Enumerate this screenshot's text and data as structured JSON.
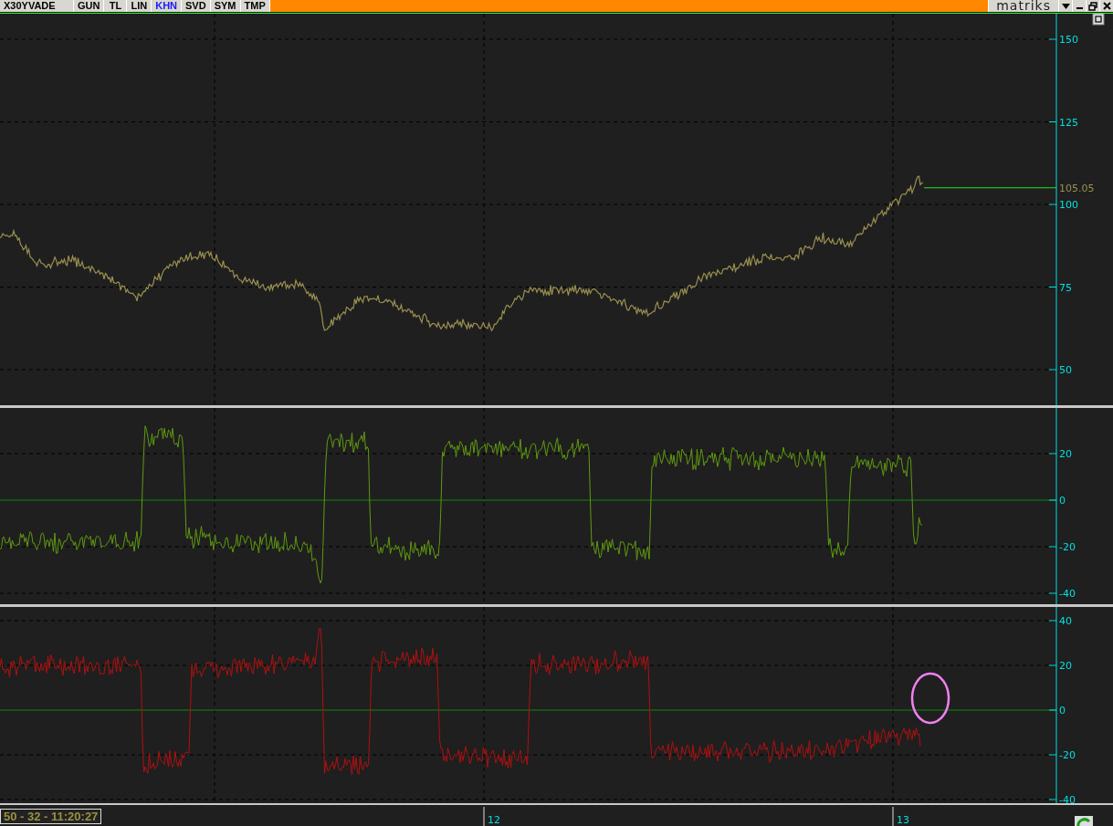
{
  "toolbar": {
    "symbol": "X30YVADE",
    "buttons": [
      {
        "label": "GUN",
        "selected": false
      },
      {
        "label": "TL",
        "selected": false
      },
      {
        "label": "LIN",
        "selected": false
      },
      {
        "label": "KHN",
        "selected": true
      },
      {
        "label": "SVD",
        "selected": false
      },
      {
        "label": "SYM",
        "selected": false
      },
      {
        "label": "TMP",
        "selected": false
      }
    ],
    "brand": "matriks"
  },
  "price_panel": {
    "y_labels": [
      "150",
      "125",
      "100",
      "75",
      "50"
    ],
    "last_price": "105.05"
  },
  "oscillator_panels": [
    {
      "y_labels": [
        "20",
        "0",
        "-20",
        "-40"
      ]
    },
    {
      "y_labels": [
        "40",
        "20",
        "0",
        "-20",
        "-40"
      ]
    }
  ],
  "time_axis": {
    "labels": [
      "12",
      "13"
    ]
  },
  "status": "50 - 32 - 11:20:27"
}
